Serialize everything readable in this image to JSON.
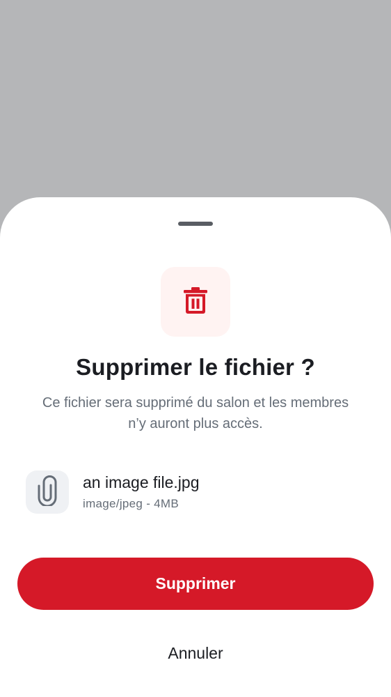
{
  "dialog": {
    "title": "Supprimer le fichier ?",
    "description": "Ce fichier sera supprimé du salon et les membres n’y auront plus accès.",
    "icon": "trash-icon",
    "accent_color": "#d51928",
    "icon_bg_color": "#fff3f2"
  },
  "file": {
    "icon": "paperclip-icon",
    "name": "an image file.jpg",
    "meta": "image/jpeg - 4MB"
  },
  "actions": {
    "delete_label": "Supprimer",
    "cancel_label": "Annuler"
  }
}
